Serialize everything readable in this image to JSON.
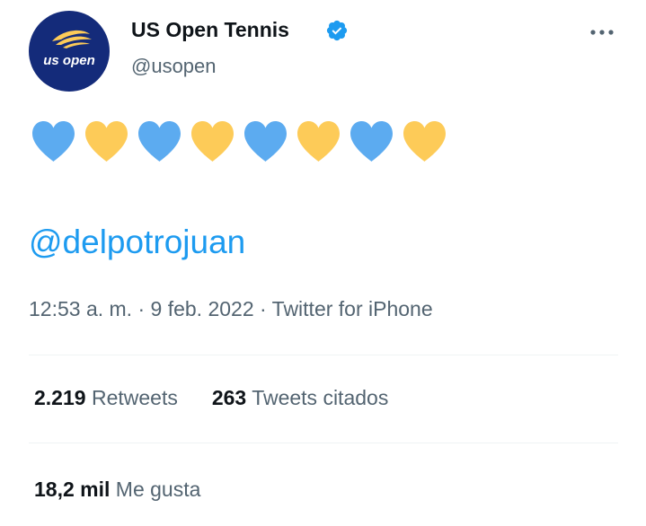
{
  "author": {
    "display_name": "US Open Tennis",
    "handle": "@usopen",
    "avatar_logo_text": "us open",
    "verified": true
  },
  "tweet": {
    "hearts": [
      "blue",
      "yellow",
      "blue",
      "yellow",
      "blue",
      "yellow",
      "blue",
      "yellow"
    ],
    "mention": "@delpotrojuan"
  },
  "meta": {
    "time": "12:53 a. m.",
    "separator": " · ",
    "date": "9 feb. 2022",
    "source": "Twitter for iPhone"
  },
  "stats": {
    "retweets_count": "2.219",
    "retweets_label": "Retweets",
    "quotes_count": "263",
    "quotes_label": "Tweets citados",
    "likes_count": "18,2 mil",
    "likes_label": "Me gusta"
  },
  "colors": {
    "heart_blue": "#5cabf0",
    "heart_yellow": "#fdcb58",
    "link": "#1d9bf0",
    "avatar_bg": "#142b7a",
    "verified": "#1d9bf0"
  },
  "icons": {
    "more": "more-horizontal-icon",
    "verified": "verified-badge-icon"
  }
}
